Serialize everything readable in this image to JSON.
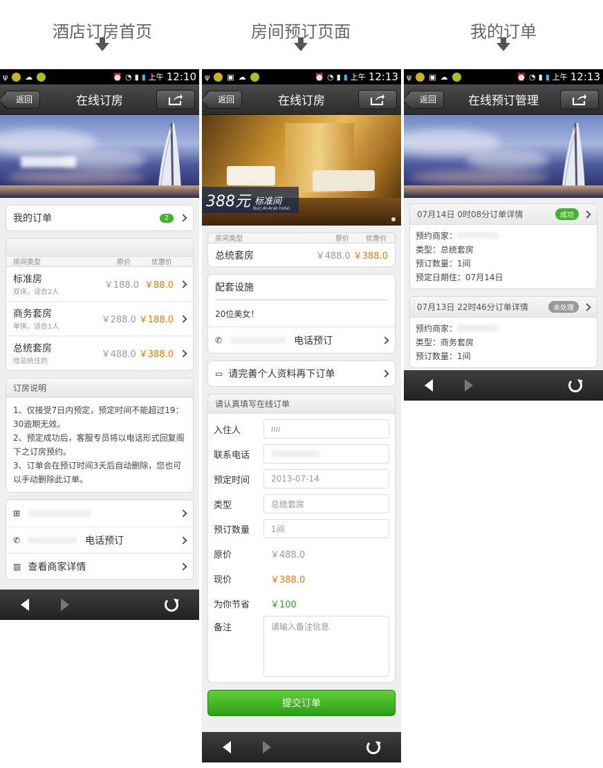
{
  "columns": [
    {
      "title": "酒店订房首页"
    },
    {
      "title": "房间预订页面"
    },
    {
      "title": "我的订单"
    }
  ],
  "status": {
    "ampm": "上午",
    "time1": "12:10",
    "time2": "12:13",
    "time3": "12:13"
  },
  "nav": {
    "back": "返回",
    "title1": "在线订房",
    "title2": "在线订房",
    "title3": "在线预订管理"
  },
  "home": {
    "my_orders": "我的订单",
    "order_count": "2",
    "col_type": "房间类型",
    "col_orig": "原价",
    "col_disc": "优惠价",
    "rooms": [
      {
        "name": "标准房",
        "desc": "双床，适合2人",
        "orig": "￥188.0",
        "disc": "￥88.0"
      },
      {
        "name": "商务套房",
        "desc": "单床，适合1人",
        "orig": "￥288.0",
        "disc": "￥188.0"
      },
      {
        "name": "总统套房",
        "desc": "给总统住的",
        "orig": "￥488.0",
        "disc": "￥388.0"
      }
    ],
    "notes_title": "订房说明",
    "notes": [
      "1、仅接受7日内预定，预定时间不能超过19：30逾期无效。",
      "2、预定成功后，客服专员将以电话形式回复阁下之订房预约。",
      "3、订单会在预订时间3天后自动删除，您也可以手动删除此订单。"
    ],
    "phone_label": "电话预订",
    "merchant_label": "查看商家详情"
  },
  "booking": {
    "price_tag": "388元",
    "room_tag": "标准间",
    "hotel_en": "Burj Al-Arab hotel",
    "col_type": "房间类型",
    "col_orig": "原价",
    "col_disc": "优惠价",
    "room_name": "总统套房",
    "room_orig": "￥488.0",
    "room_disc": "￥388.0",
    "facility_title": "配套设施",
    "facility_value": "20位美女！",
    "phone_label": "电话预订",
    "profile_prompt": "请完善个人资料再下订单",
    "form_title": "请认真填写在线订单",
    "f_guest": "入住人",
    "f_guest_val": "ıııı",
    "f_phone": "联系电话",
    "f_time": "预定时间",
    "f_time_val": "2013-07-14",
    "f_type": "类型",
    "f_type_val": "总统套房",
    "f_qty": "预订数量",
    "f_qty_val": "1间",
    "f_orig": "原价",
    "f_orig_val": "￥488.0",
    "f_now": "现价",
    "f_now_val": "￥388.0",
    "f_save": "为你节省",
    "f_save_val": "￥100",
    "f_note": "备注",
    "f_note_ph": "请输入备注信息",
    "submit": "提交订单"
  },
  "orders": [
    {
      "header": "07月14日 0时08分订单详情",
      "status": "成功",
      "merchant": "预约商家：",
      "type": "类型：总统套房",
      "qty": "预订数量：1间",
      "date": "预定日期住：07月14日"
    },
    {
      "header": "07月13日 22时46分订单详情",
      "status": "未处理",
      "merchant": "预约商家：",
      "type": "类型：商务套房",
      "qty": "预订数量：1间"
    }
  ]
}
